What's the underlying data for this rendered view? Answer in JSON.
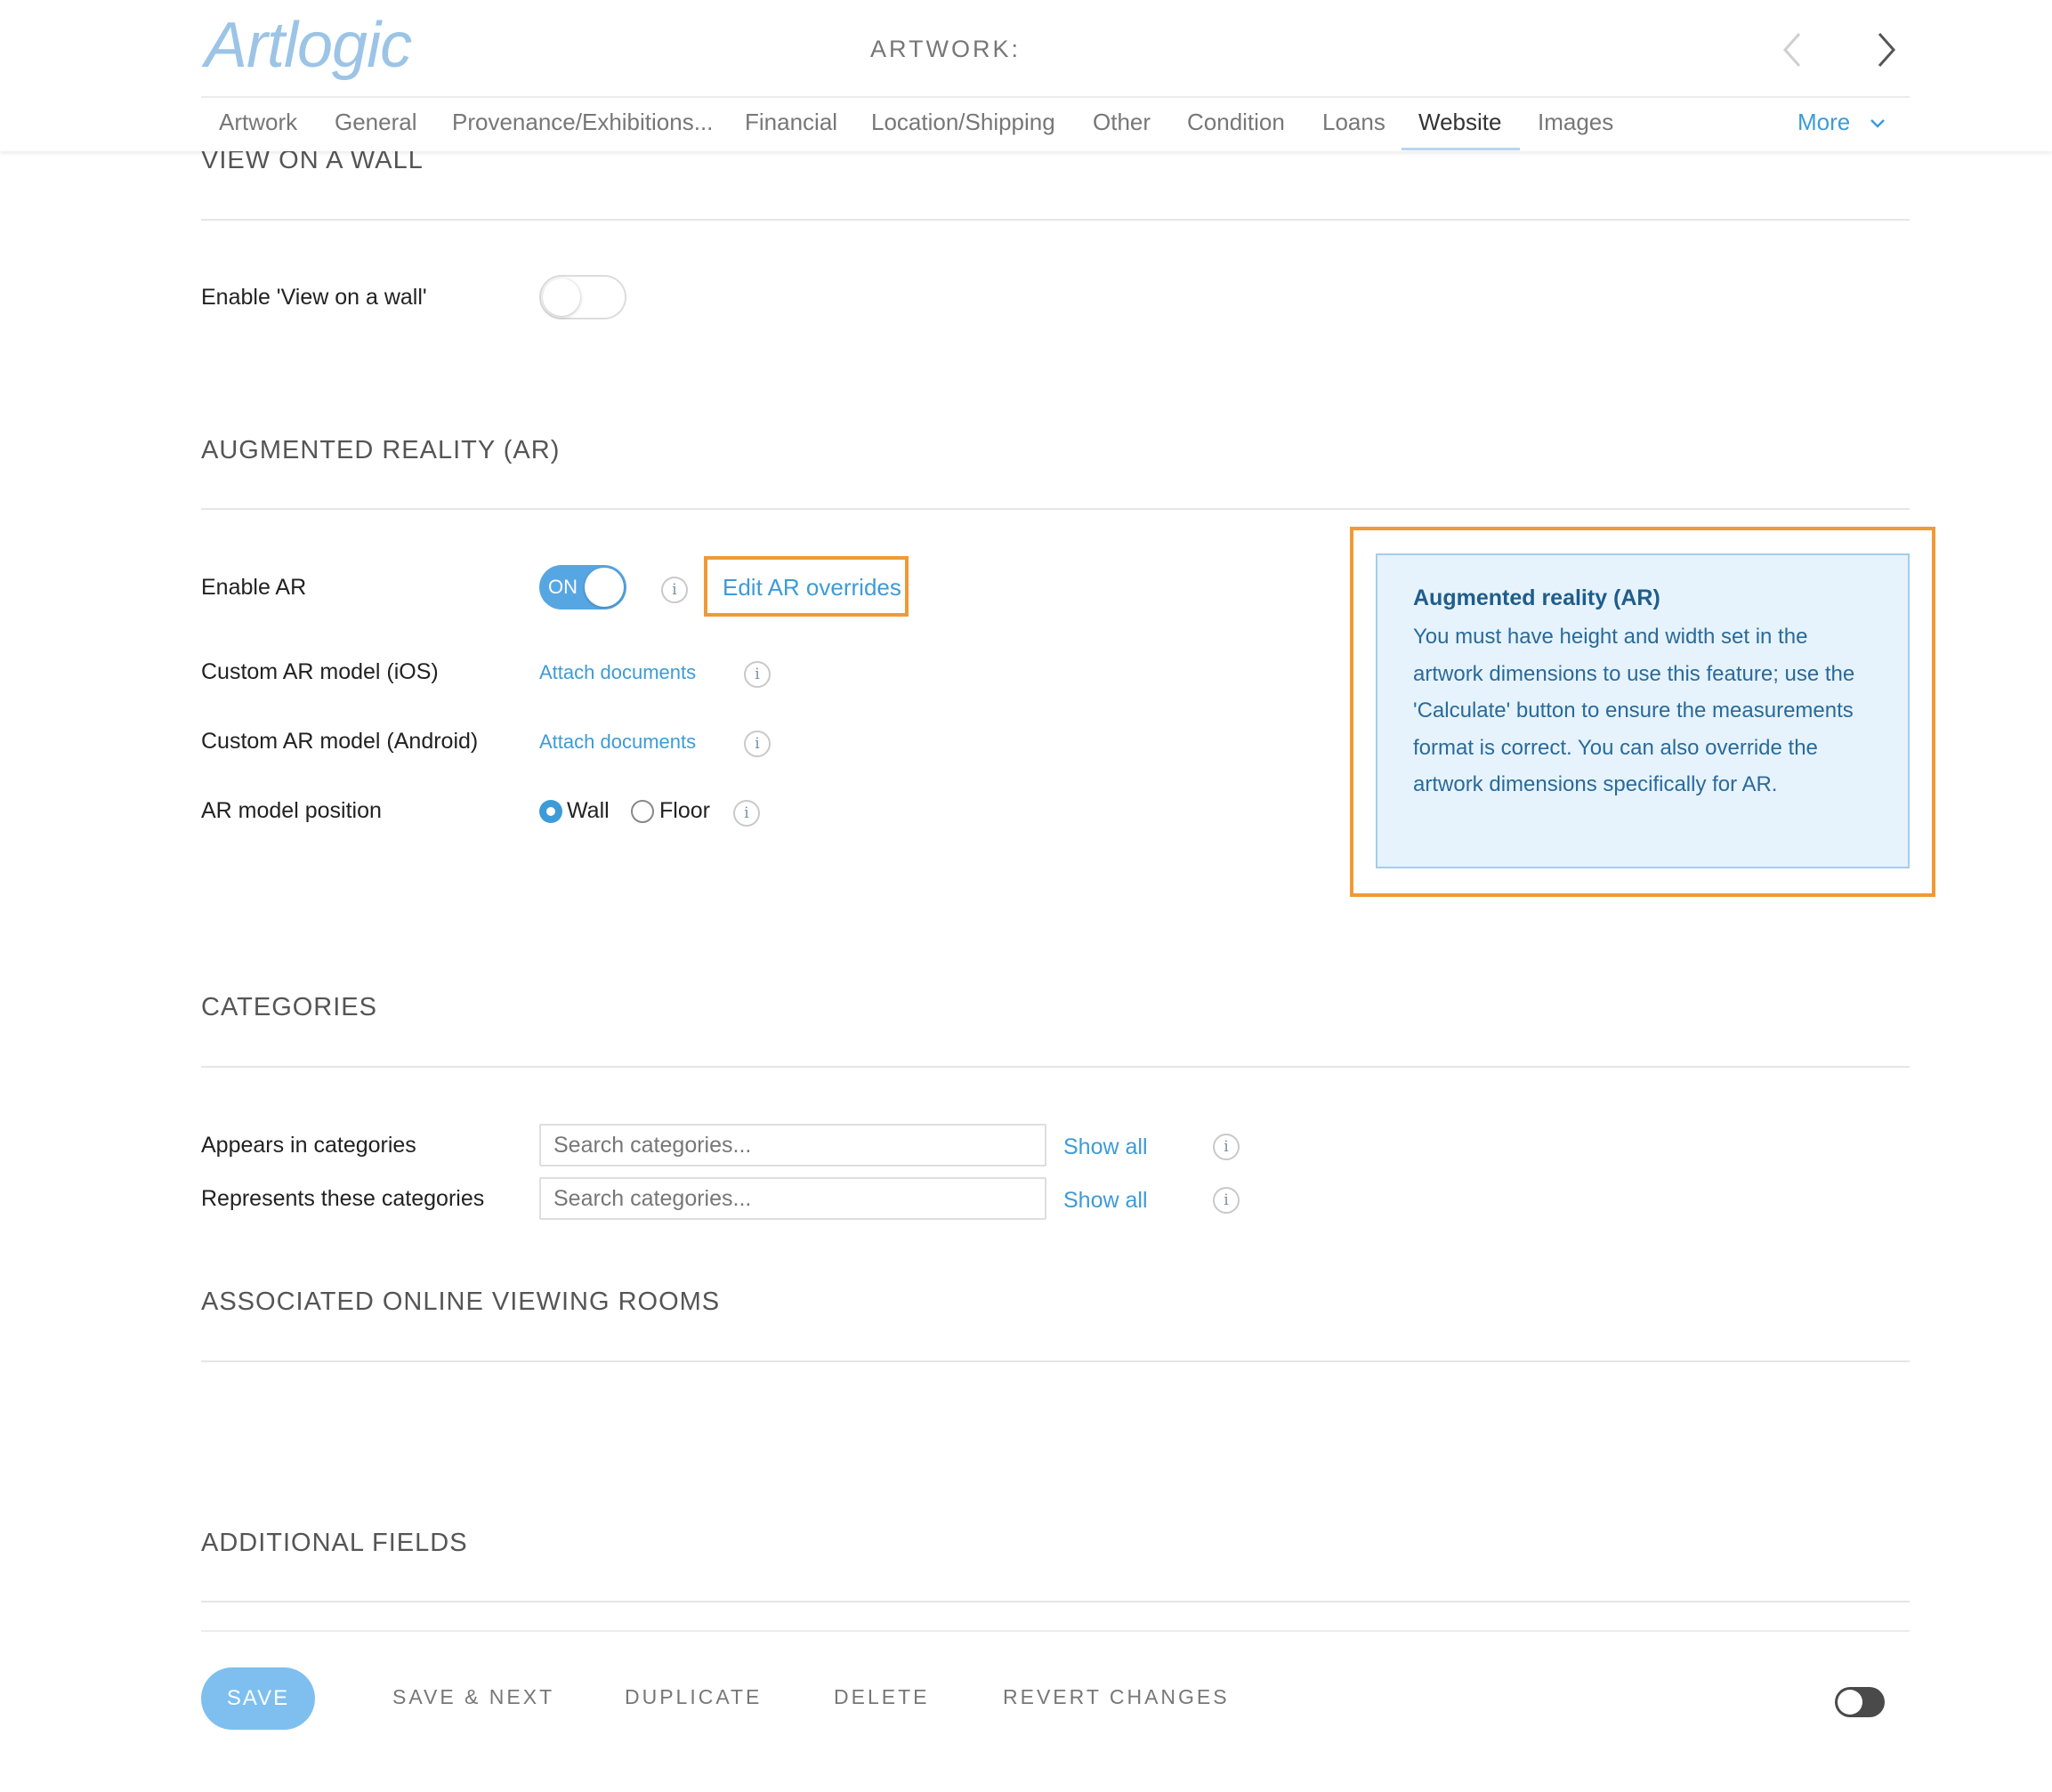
{
  "header": {
    "logo": "Artlogic",
    "artwork_label": "ARTWORK:",
    "tabs": [
      "Artwork",
      "General",
      "Provenance/Exhibitions...",
      "Financial",
      "Location/Shipping",
      "Other",
      "Condition",
      "Loans",
      "Website",
      "Images"
    ],
    "active_tab": "Website",
    "more_label": "More"
  },
  "view_on_wall": {
    "title": "VIEW ON A WALL",
    "enable_label": "Enable 'View on a wall'",
    "enabled": false
  },
  "ar": {
    "title": "AUGMENTED REALITY (AR)",
    "enable_label": "Enable AR",
    "toggle_on_text": "ON",
    "enabled": true,
    "edit_overrides_label": "Edit AR overrides",
    "ios_label": "Custom AR model (iOS)",
    "android_label": "Custom AR model (Android)",
    "attach_label": "Attach documents",
    "position_label": "AR model position",
    "position_options": [
      "Wall",
      "Floor"
    ],
    "position_selected": "Wall",
    "info_icon": "i",
    "info_box": {
      "title": "Augmented reality (AR)",
      "body": "You must have height and width set in the artwork dimensions to use this feature; use the 'Calculate' button to ensure the measurements format is correct. You can also override the artwork dimensions specifically for AR."
    }
  },
  "categories": {
    "title": "CATEGORIES",
    "appears_label": "Appears in categories",
    "represents_label": "Represents these categories",
    "search_placeholder": "Search categories...",
    "show_all_label": "Show all"
  },
  "ovr": {
    "title": "ASSOCIATED ONLINE VIEWING ROOMS"
  },
  "additional": {
    "title": "ADDITIONAL FIELDS"
  },
  "footer": {
    "save": "SAVE",
    "save_next": "SAVE & NEXT",
    "duplicate": "DUPLICATE",
    "delete": "DELETE",
    "revert": "REVERT CHANGES"
  },
  "colors": {
    "accent": "#3d9bd8",
    "highlight": "#f09a36",
    "info_bg": "#e6f3fd"
  }
}
